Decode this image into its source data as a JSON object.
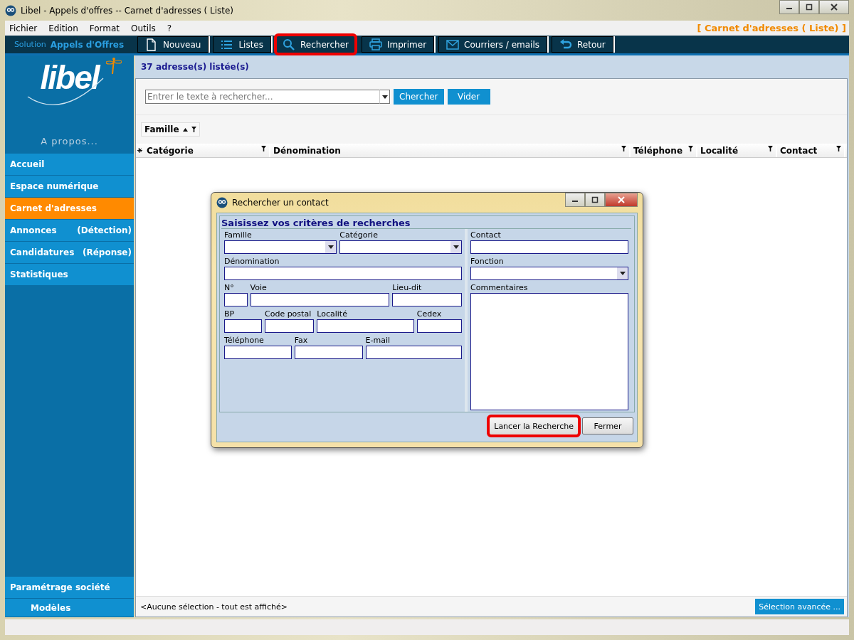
{
  "window": {
    "title": "Libel - Appels d'offres -- Carnet d'adresses ( Liste)"
  },
  "menu": [
    "Fichier",
    "Edition",
    "Format",
    "Outils",
    "?"
  ],
  "context_title": "[ Carnet d'adresses ( Liste) ]",
  "brand": {
    "prefix": "Solution",
    "name": "Appels d'Offres"
  },
  "toolbar": [
    {
      "label": "Nouveau",
      "highlighted": false
    },
    {
      "label": "Listes",
      "highlighted": false
    },
    {
      "label": "Rechercher",
      "highlighted": true
    },
    {
      "label": "Imprimer",
      "highlighted": false
    },
    {
      "label": "Courriers / emails",
      "highlighted": false
    },
    {
      "label": "Retour",
      "highlighted": false
    }
  ],
  "sidebar": {
    "logo": "libel",
    "about": "A propos...",
    "items": [
      {
        "label": "Accueil",
        "selected": false
      },
      {
        "label": "Espace numérique",
        "selected": false
      },
      {
        "label": "Carnet d'adresses",
        "selected": true
      },
      {
        "label": "Annonces",
        "note": "(Détection)",
        "selected": false
      },
      {
        "label": "Candidatures",
        "note": "(Réponse)",
        "selected": false
      },
      {
        "label": "Statistiques",
        "selected": false
      }
    ],
    "bottom_items": [
      {
        "label": "Paramétrage société",
        "kind": "main"
      },
      {
        "label": "Modèles",
        "kind": "sub"
      }
    ]
  },
  "count": "37 adresse(s) listée(s)",
  "search": {
    "placeholder": "Entrer le texte à rechercher...",
    "buttons": [
      "Chercher",
      "Vider"
    ]
  },
  "group_by": "Famille",
  "table": {
    "columns": [
      "Catégorie",
      "Dénomination",
      "Téléphone",
      "Localité",
      "Contact"
    ]
  },
  "selection_status": "<Aucune sélection - tout est affiché>",
  "advanced_button": "Sélection avancée ...",
  "dialog": {
    "title": "Rechercher un contact",
    "heading": "Saisissez vos critères de recherches",
    "left_rows": [
      [
        {
          "label": "Famille",
          "kind": "combo"
        },
        {
          "label": "Catégorie",
          "kind": "combo"
        }
      ],
      [
        {
          "label": "Dénomination",
          "kind": "text"
        }
      ],
      [
        {
          "label": "N°",
          "kind": "text"
        },
        {
          "label": "Voie",
          "kind": "text"
        },
        {
          "label": "Lieu-dit",
          "kind": "text"
        }
      ],
      [
        {
          "label": "BP",
          "kind": "text"
        },
        {
          "label": "Code postal",
          "kind": "text"
        },
        {
          "label": "Localité",
          "kind": "text"
        },
        {
          "label": "Cedex",
          "kind": "text"
        }
      ],
      [
        {
          "label": "Téléphone",
          "kind": "text"
        },
        {
          "label": "Fax",
          "kind": "text"
        },
        {
          "label": "E-mail",
          "kind": "text"
        }
      ]
    ],
    "right_fields": [
      {
        "label": "Contact",
        "kind": "text"
      },
      {
        "label": "Fonction",
        "kind": "combo"
      },
      {
        "label": "Commentaires",
        "kind": "textarea"
      }
    ],
    "buttons": [
      {
        "label": "Lancer la Recherche",
        "highlighted": true
      },
      {
        "label": "Fermer",
        "highlighted": false
      }
    ]
  }
}
